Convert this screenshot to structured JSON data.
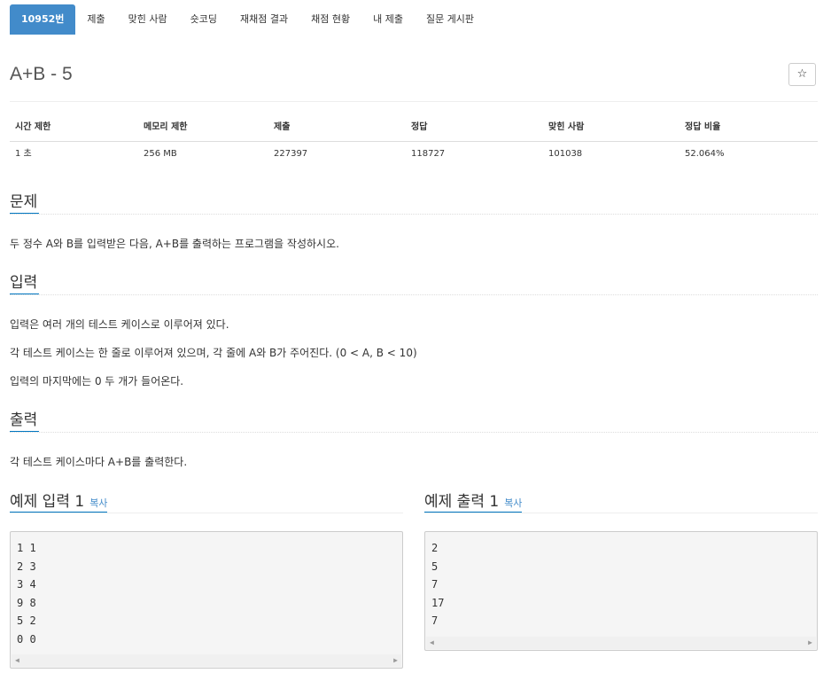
{
  "tabs": [
    "10952번",
    "제출",
    "맞힌 사람",
    "숏코딩",
    "재채점 결과",
    "채점 현황",
    "내 제출",
    "질문 게시판"
  ],
  "problem": {
    "title": "A+B - 5",
    "star": "☆"
  },
  "info": {
    "headers": [
      "시간 제한",
      "메모리 제한",
      "제출",
      "정답",
      "맞힌 사람",
      "정답 비율"
    ],
    "values": [
      "1 초",
      "256 MB",
      "227397",
      "118727",
      "101038",
      "52.064%"
    ]
  },
  "sections": {
    "problem": {
      "heading": "문제",
      "lines": [
        "두 정수 A와 B를 입력받은 다음, A+B를 출력하는 프로그램을 작성하시오."
      ]
    },
    "input": {
      "heading": "입력",
      "lines": [
        "입력은 여러 개의 테스트 케이스로 이루어져 있다.",
        "각 테스트 케이스는 한 줄로 이루어져 있으며, 각 줄에 A와 B가 주어진다. (0 < A, B < 10)",
        "입력의 마지막에는 0 두 개가 들어온다."
      ]
    },
    "output": {
      "heading": "출력",
      "lines": [
        "각 테스트 케이스마다 A+B를 출력한다."
      ]
    }
  },
  "samples": {
    "input": {
      "heading": "예제 입력 1",
      "copy": "복사",
      "lines": [
        "1 1",
        "2 3",
        "3 4",
        "9 8",
        "5 2",
        "0 0"
      ]
    },
    "output": {
      "heading": "예제 출력 1",
      "copy": "복사",
      "lines": [
        "2",
        "5",
        "7",
        "17",
        "7"
      ]
    }
  },
  "icons": {
    "scroll_left": "◀",
    "scroll_right": "▶"
  },
  "colors": {
    "accent": "#428bca",
    "heading_underline": "#0076c0"
  }
}
